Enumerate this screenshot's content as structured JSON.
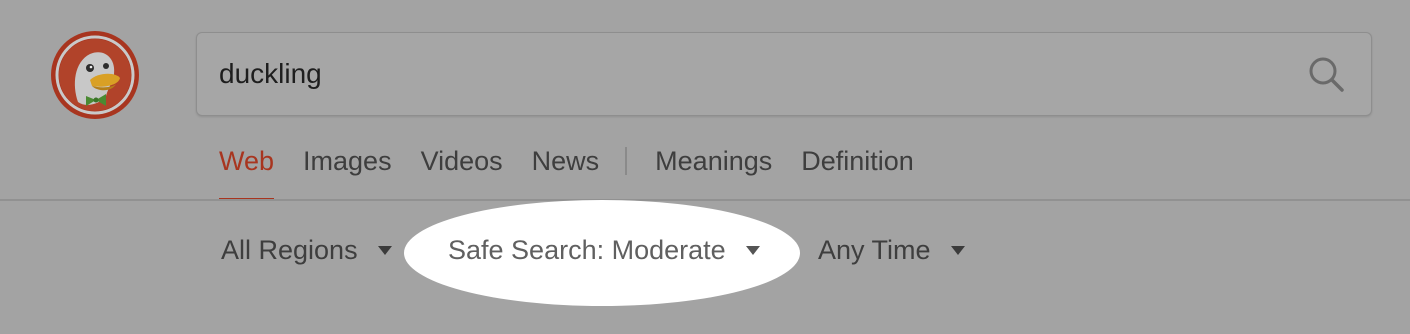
{
  "search": {
    "query": "duckling"
  },
  "tabs": [
    {
      "label": "Web",
      "active": true
    },
    {
      "label": "Images"
    },
    {
      "label": "Videos"
    },
    {
      "label": "News"
    },
    {
      "label": "Meanings"
    },
    {
      "label": "Definition"
    }
  ],
  "filters": {
    "region": "All Regions",
    "safe_search": "Safe Search: Moderate",
    "time": "Any Time"
  },
  "colors": {
    "background": "#a3a3a3",
    "active_tab": "#a8351f",
    "highlight": "#ffffff"
  },
  "icons": {
    "logo": "duckduckgo-logo",
    "search": "magnifier-icon"
  }
}
